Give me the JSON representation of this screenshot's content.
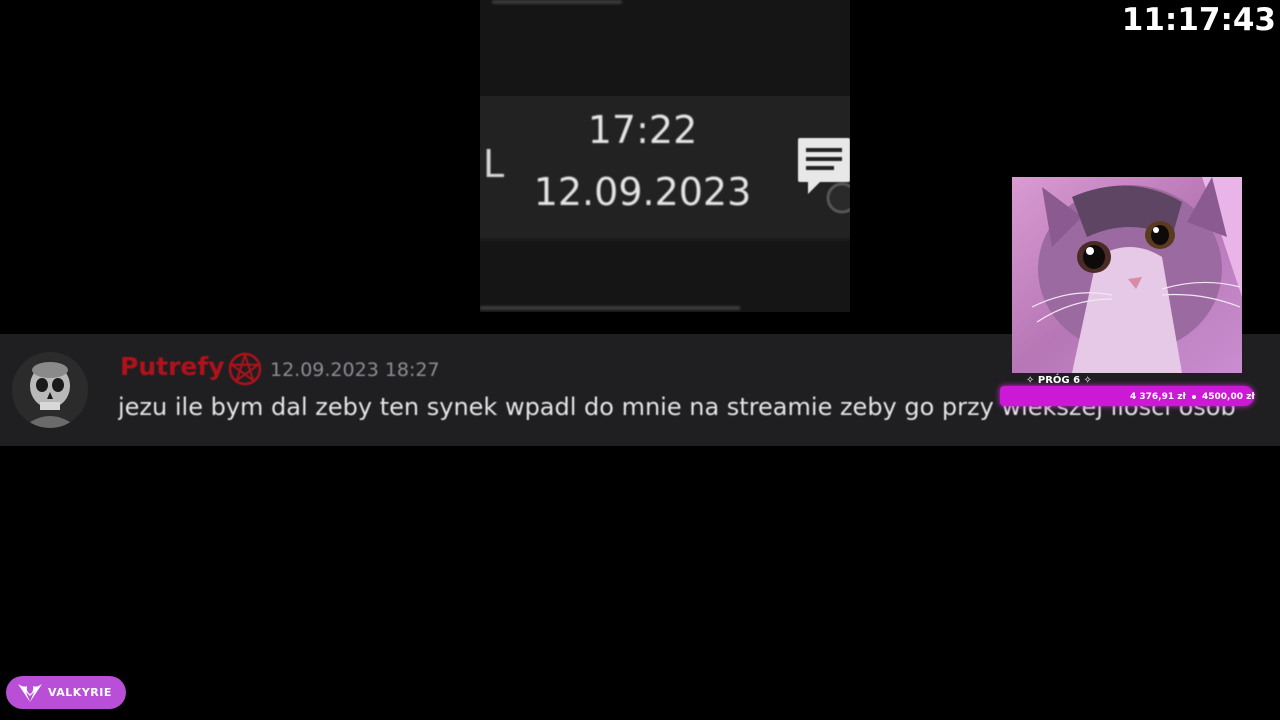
{
  "overlay": {
    "clock": "11:17:43"
  },
  "taskbar_crop": {
    "partial_letter": "L",
    "time": "17:22",
    "date": "12.09.2023",
    "notification_icon": "notification-chat-icon"
  },
  "message": {
    "username": "Putrefy",
    "username_color": "#b0121b",
    "role_icon": "pentagram-icon",
    "timestamp": "12.09.2023 18:27",
    "text": "jezu ile bym dal zeby ten synek wpadl do mnie na streamie zeby go przy wiekszej ilosci osob"
  },
  "donation_goal": {
    "label": "✧ PRÓG 6 ✧",
    "current": "4 376,91 zł",
    "target": "4500,00 zł",
    "progress_fraction": 0.97,
    "bar_color": "#cc19d6"
  },
  "brand": {
    "name": "VALKYRIE",
    "icon": "valkyrie-wings-icon",
    "color": "#b84fd6"
  }
}
